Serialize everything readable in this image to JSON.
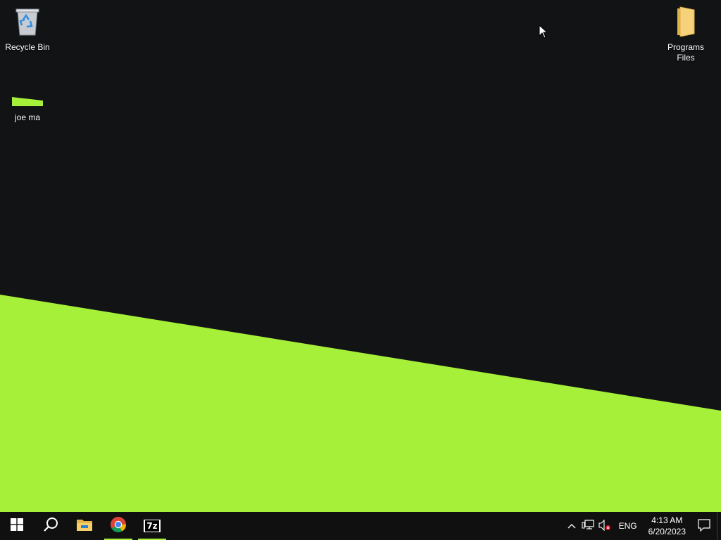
{
  "desktop": {
    "wallpaper_colors": {
      "dark": "#121315",
      "accent": "#a6f03a"
    },
    "icons": [
      {
        "label": "Recycle Bin",
        "icon": "recycle-bin-icon"
      },
      {
        "label": "joe ma",
        "icon": "green-shortcut-icon"
      },
      {
        "label": "Programs Files",
        "icon": "folder-icon"
      }
    ]
  },
  "taskbar": {
    "buttons": [
      {
        "name": "start",
        "icon": "windows-logo-icon"
      },
      {
        "name": "search",
        "icon": "search-icon"
      },
      {
        "name": "file-explorer",
        "icon": "file-explorer-icon"
      },
      {
        "name": "chrome",
        "icon": "chrome-icon"
      },
      {
        "name": "7zip",
        "icon": "7zip-icon",
        "text": "7z"
      }
    ],
    "tray": {
      "language": "ENG",
      "time": "4:13 AM",
      "date": "6/20/2023"
    }
  }
}
